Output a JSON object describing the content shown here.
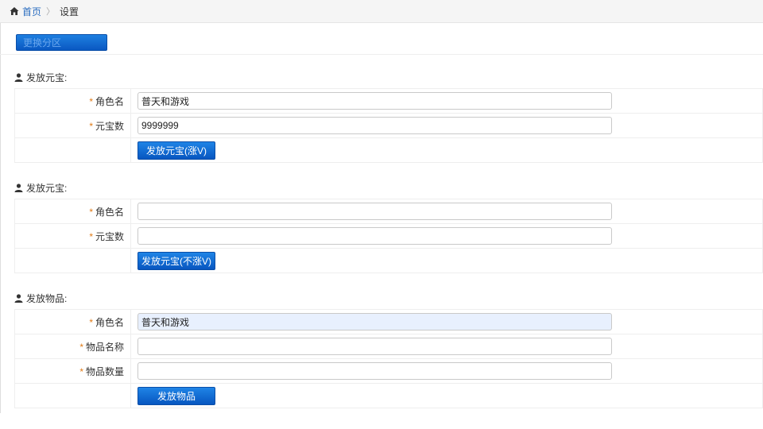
{
  "breadcrumb": {
    "home": "首页",
    "current": "设置"
  },
  "toolbar": {
    "switch_label": "更换分区"
  },
  "section1": {
    "title": "发放元宝:",
    "role_label": "角色名",
    "role_value": "普天和游戏",
    "amount_label": "元宝数",
    "amount_value": "9999999",
    "button": "发放元宝(涨V)"
  },
  "section2": {
    "title": "发放元宝:",
    "role_label": "角色名",
    "role_value": "",
    "amount_label": "元宝数",
    "amount_value": "",
    "button": "发放元宝(不涨V)"
  },
  "section3": {
    "title": "发放物品:",
    "role_label": "角色名",
    "role_value": "普天和游戏",
    "item_label": "物品名称",
    "item_value": "",
    "qty_label": "物品数量",
    "qty_value": "",
    "button": "发放物品"
  },
  "required_mark": "*"
}
